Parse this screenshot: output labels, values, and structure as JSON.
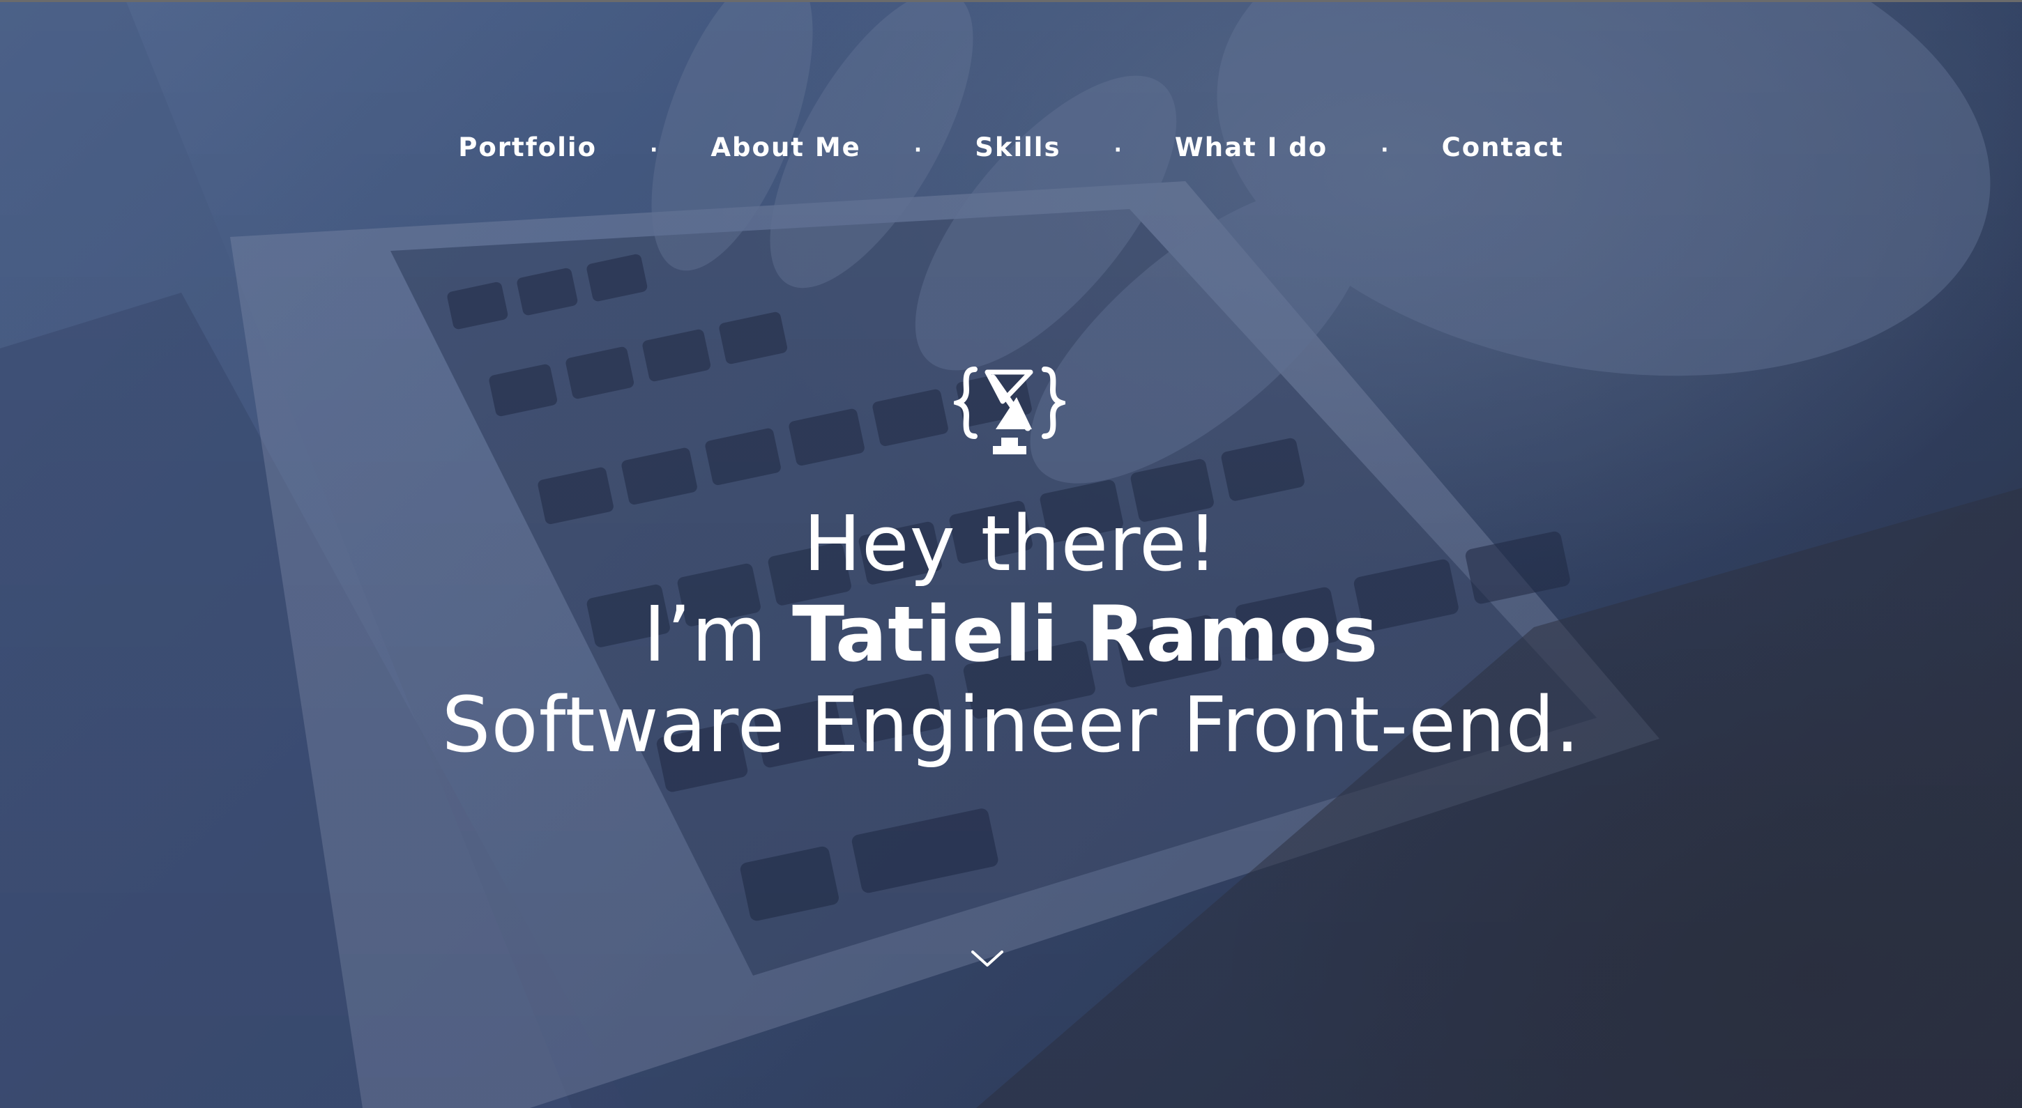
{
  "nav": {
    "items": [
      {
        "label": "Portfolio"
      },
      {
        "label": "About Me"
      },
      {
        "label": "Skills"
      },
      {
        "label": "What I do"
      },
      {
        "label": "Contact"
      }
    ],
    "separator": "·"
  },
  "hero": {
    "greeting": "Hey there!",
    "intro_prefix": "I’m",
    "name": "Tatieli Ramos",
    "role": "Software Engineer Front-end."
  },
  "icons": {
    "logo": "code-trophy-logo-icon",
    "scroll": "chevron-down-icon"
  },
  "colors": {
    "text": "#ffffff",
    "overlay": "#3c5078"
  }
}
